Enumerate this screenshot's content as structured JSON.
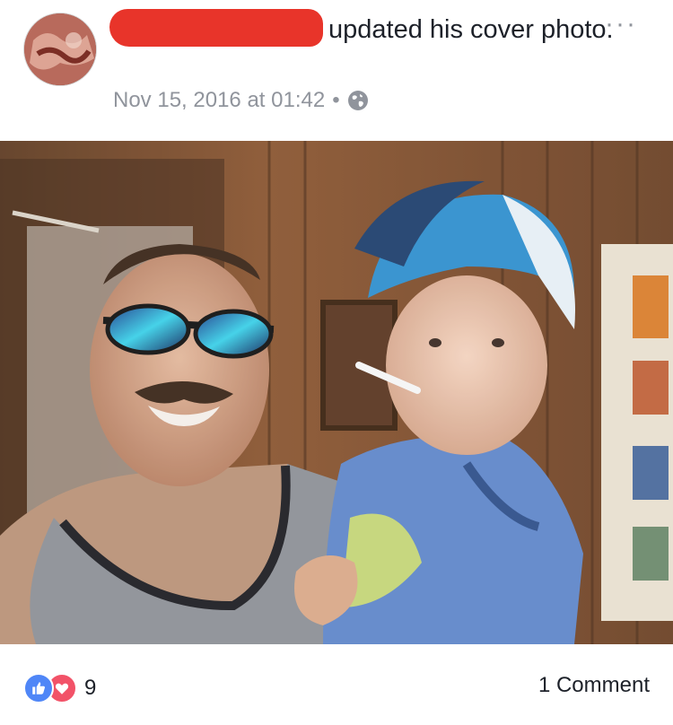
{
  "post": {
    "headline_text": "updated his cover photo.",
    "timestamp": "Nov 15, 2016 at 01:42",
    "separator": "•",
    "privacy_icon": "globe-icon",
    "more_label": "···"
  },
  "author": {
    "avatar_icon": "profile-avatar"
  },
  "footer": {
    "reaction_icons": [
      "like-icon",
      "love-icon"
    ],
    "reaction_count": "9",
    "comment_label": "1 Comment"
  },
  "colors": {
    "redaction": "#e8342a",
    "meta_text": "#90949c",
    "like": "#4f86f7",
    "love": "#f25268"
  }
}
